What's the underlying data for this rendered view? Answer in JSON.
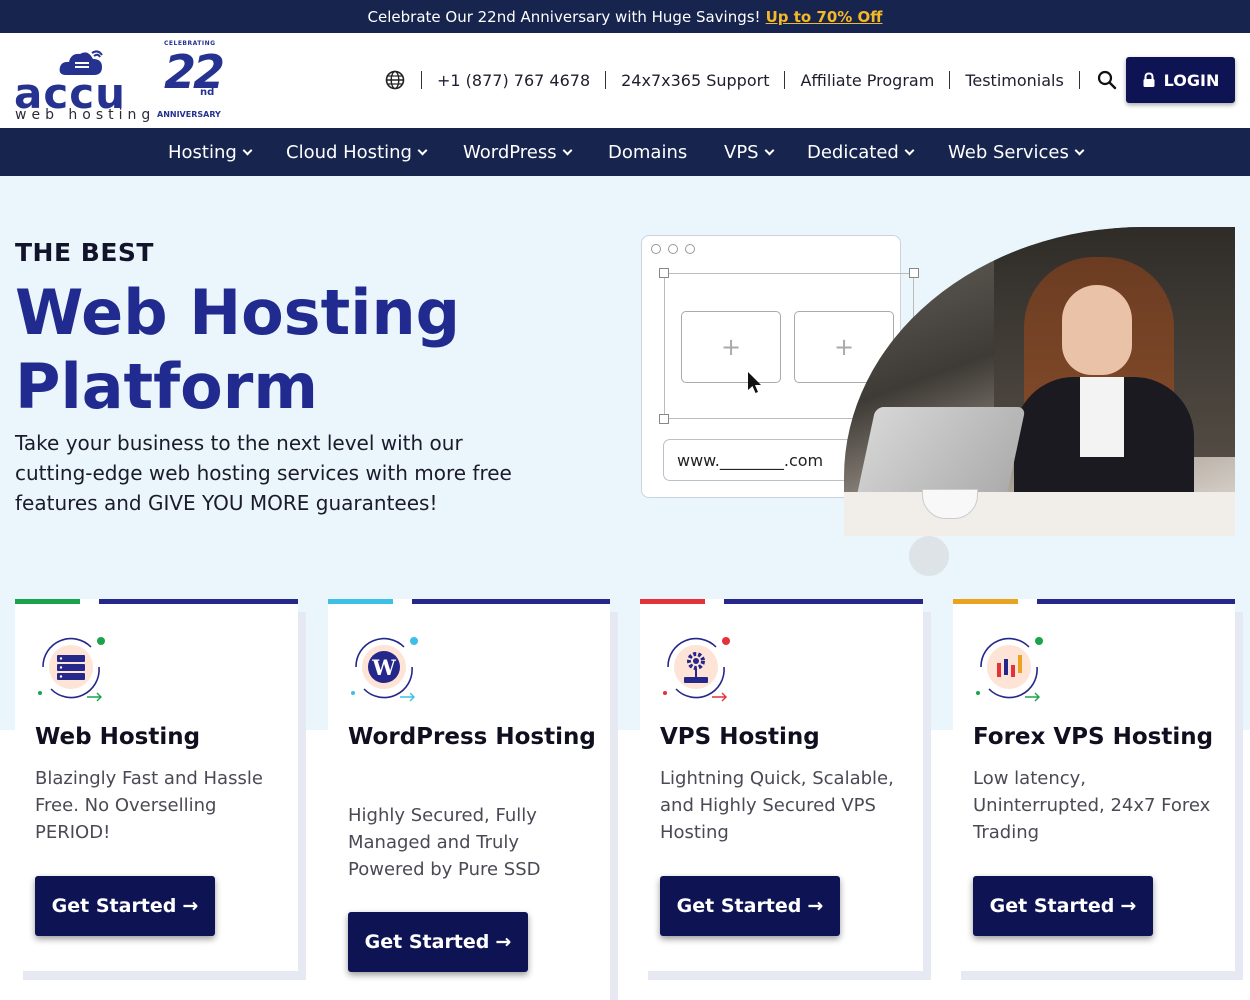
{
  "promo": {
    "text": "Celebrate Our 22nd Anniversary with Huge Savings!",
    "link": "Up to 70% Off"
  },
  "logo": {
    "word": "accu",
    "sub": "web hosting",
    "anniv_top": "CELEBRATING",
    "anniv_number": "22",
    "anniv_suffix": "nd",
    "anniv_bottom": "ANNIVERSARY"
  },
  "topnav": {
    "phone": "+1 (877) 767 4678",
    "support": "24x7x365 Support",
    "affiliate": "Affiliate Program",
    "testimonials": "Testimonials",
    "login": "LOGIN"
  },
  "mainnav": [
    "Hosting",
    "Cloud Hosting",
    "WordPress",
    "Domains",
    "VPS",
    "Dedicated",
    "Web Services"
  ],
  "hero": {
    "eyebrow": "THE BEST",
    "title": "Web Hosting Platform",
    "description": "Take your business to the next level with our cutting-edge web hosting services with more free features and GIVE YOU MORE guarantees!",
    "url_field": "www.________.com"
  },
  "cards": [
    {
      "title": "Web Hosting",
      "desc": "Blazingly Fast and Hassle Free. No Overselling PERIOD!",
      "button": "Get Started",
      "accent": "#1aa34a"
    },
    {
      "title": "WordPress Hosting",
      "desc": "Highly Secured, Fully Managed and Truly Powered by Pure SSD",
      "button": "Get Started",
      "accent": "#3cc0e6"
    },
    {
      "title": "VPS Hosting",
      "desc": "Lightning Quick, Scalable, and Highly Secured VPS Hosting",
      "button": "Get Started",
      "accent": "#e2323a"
    },
    {
      "title": "Forex VPS Hosting",
      "desc": "Low latency, Uninterrupted, 24x7 Forex Trading",
      "button": "Get Started",
      "accent": "#e9a31f"
    }
  ],
  "colors": {
    "navy": "#16244e",
    "brand_blue": "#212a8f",
    "button": "#0e1354",
    "promo_link": "#f5b827",
    "hero_bg": "#eaf6fb"
  }
}
